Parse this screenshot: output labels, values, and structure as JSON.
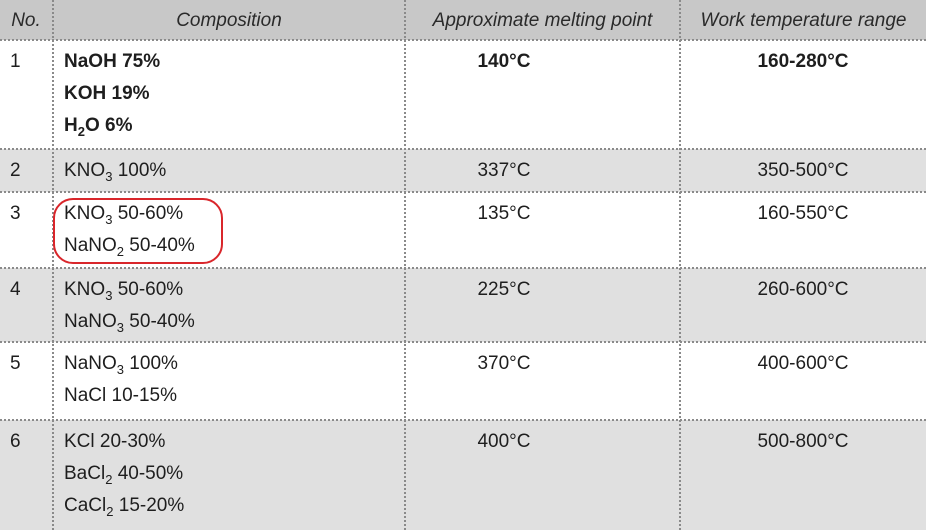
{
  "table": {
    "headers": [
      "No.",
      "Composition",
      "Approximate melting point",
      "Work temperature range"
    ],
    "rows": [
      {
        "no": "1",
        "composition": [
          {
            "formula": "NaOH",
            "sub": "",
            "after": "",
            "amount": "75%"
          },
          {
            "formula": "KOH",
            "sub": "",
            "after": "",
            "amount": "19%"
          },
          {
            "formula": "H",
            "sub": "2",
            "after": "O",
            "amount": "6%"
          }
        ],
        "melting_point": "140°C",
        "work_range": "160-280°C",
        "bold": true
      },
      {
        "no": "2",
        "composition": [
          {
            "formula": "KNO",
            "sub": "3",
            "after": "",
            "amount": "100%"
          }
        ],
        "melting_point": "337°C",
        "work_range": "350-500°C"
      },
      {
        "no": "3",
        "composition": [
          {
            "formula": "KNO",
            "sub": "3",
            "after": "",
            "amount": "50-60%"
          },
          {
            "formula": "NaNO",
            "sub": "2",
            "after": "",
            "amount": "50-40%"
          }
        ],
        "melting_point": "135°C",
        "work_range": "160-550°C",
        "highlighted": true
      },
      {
        "no": "4",
        "composition": [
          {
            "formula": "KNO",
            "sub": "3",
            "after": "",
            "amount": "50-60%"
          },
          {
            "formula": "NaNO",
            "sub": "3",
            "after": "",
            "amount": "50-40%"
          }
        ],
        "melting_point": "225°C",
        "work_range": "260-600°C"
      },
      {
        "no": "5",
        "composition": [
          {
            "formula": "NaNO",
            "sub": "3",
            "after": "",
            "amount": "100%"
          },
          {
            "formula": "NaCl",
            "sub": "",
            "after": "",
            "amount": "10-15%"
          }
        ],
        "melting_point": "370°C",
        "work_range": "400-600°C"
      },
      {
        "no": "6",
        "composition": [
          {
            "formula": "KCl",
            "sub": "",
            "after": "",
            "amount": "20-30%"
          },
          {
            "formula": "BaCl",
            "sub": "2",
            "after": "",
            "amount": "40-50%"
          },
          {
            "formula": "CaCl",
            "sub": "2",
            "after": "",
            "amount": "15-20%"
          }
        ],
        "melting_point": "400°C",
        "work_range": "500-800°C"
      }
    ]
  },
  "colors": {
    "header_bg": "#c8c8c8",
    "shaded_row_bg": "#e0e0e0",
    "highlight_border": "#d9262b"
  }
}
